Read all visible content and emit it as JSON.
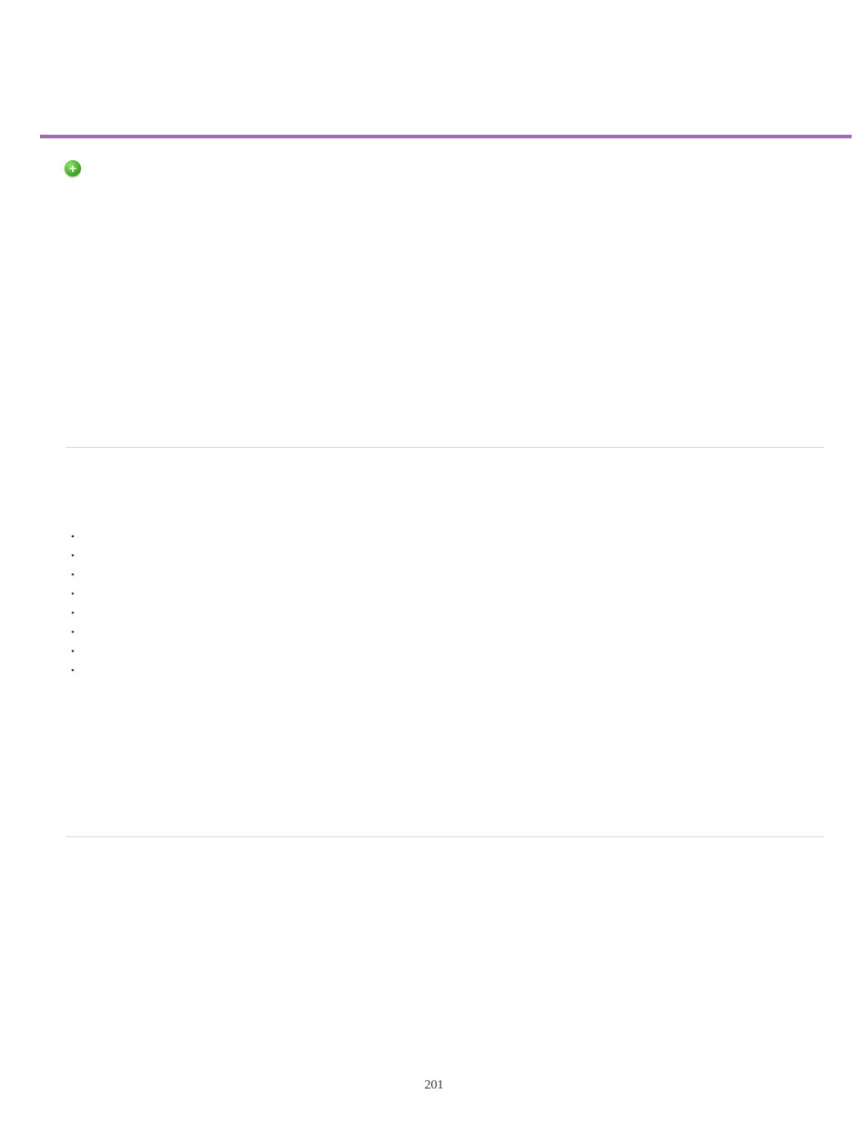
{
  "plus_label": "+",
  "bullets": [
    "",
    "",
    "",
    "",
    "",
    "",
    "",
    ""
  ],
  "page_number": "201"
}
